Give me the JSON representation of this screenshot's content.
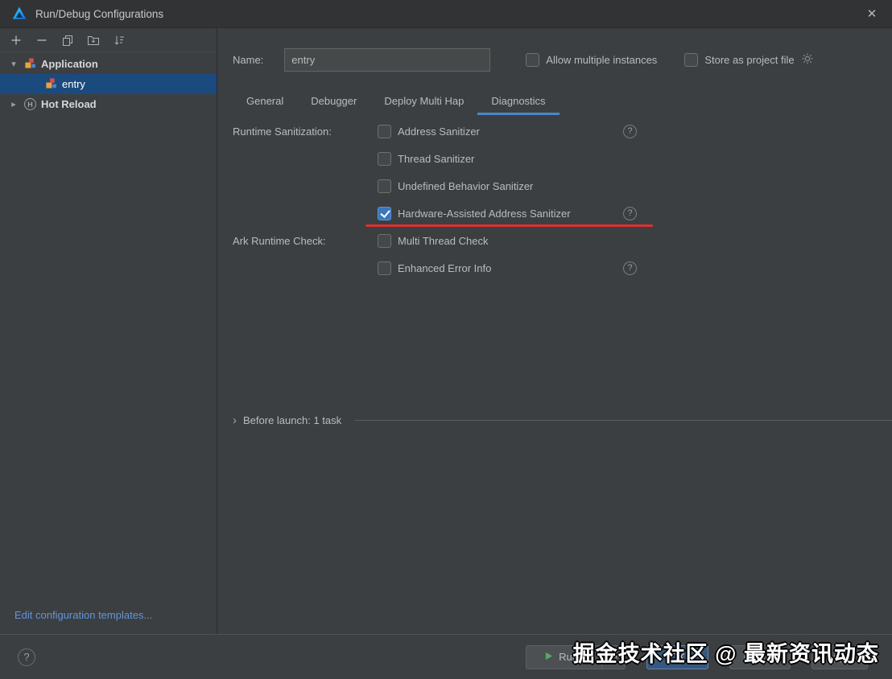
{
  "titlebar": {
    "title": "Run/Debug Configurations"
  },
  "icons": {
    "close": "✕",
    "help": "?",
    "chevron_down": "▾",
    "chevron_right": "▸",
    "arrow": "›",
    "hot_reload_letter": "H"
  },
  "toolbar": {
    "icons": [
      "add",
      "remove",
      "copy",
      "move-into-folder",
      "sort"
    ]
  },
  "sidebar": {
    "items": [
      {
        "label": "Application",
        "type": "group",
        "expanded": true
      },
      {
        "label": "entry",
        "type": "configuration",
        "selected": true
      },
      {
        "label": "Hot Reload",
        "type": "group",
        "expanded": false
      }
    ],
    "edit_link": "Edit configuration templates..."
  },
  "header": {
    "name_label": "Name:",
    "name_value": "entry",
    "allow_multiple": "Allow multiple instances",
    "allow_multiple_checked": false,
    "store_as_project": "Store as project file",
    "store_as_project_checked": false
  },
  "tabs": [
    {
      "label": "General",
      "active": false
    },
    {
      "label": "Debugger",
      "active": false
    },
    {
      "label": "Deploy Multi Hap",
      "active": false
    },
    {
      "label": "Diagnostics",
      "active": true
    }
  ],
  "diagnostics": {
    "runtime_label": "Runtime Sanitization:",
    "ark_label": "Ark Runtime Check:",
    "options": [
      {
        "label": "Address Sanitizer",
        "checked": false,
        "help": true
      },
      {
        "label": "Thread Sanitizer",
        "checked": false,
        "help": false
      },
      {
        "label": "Undefined Behavior Sanitizer",
        "checked": false,
        "help": false
      },
      {
        "label": "Hardware-Assisted Address Sanitizer",
        "checked": true,
        "help": true,
        "annotated_red_underline": true
      },
      {
        "label": "Multi Thread Check",
        "checked": false,
        "help": false
      },
      {
        "label": "Enhanced Error Info",
        "checked": false,
        "help": true
      }
    ]
  },
  "before_launch": {
    "label": "Before launch: 1 task"
  },
  "footer": {
    "run": "Run",
    "ok": "OK",
    "cancel": "Cancel",
    "apply": "Apply"
  },
  "watermark": "掘金技术社区 @ 最新资讯动态",
  "colors": {
    "accent": "#4a88c7",
    "selection": "#1b4a7e",
    "annotation_red": "#dd2f2f",
    "link": "#6494d6",
    "run_green": "#59a869",
    "background": "#3c3f41"
  }
}
